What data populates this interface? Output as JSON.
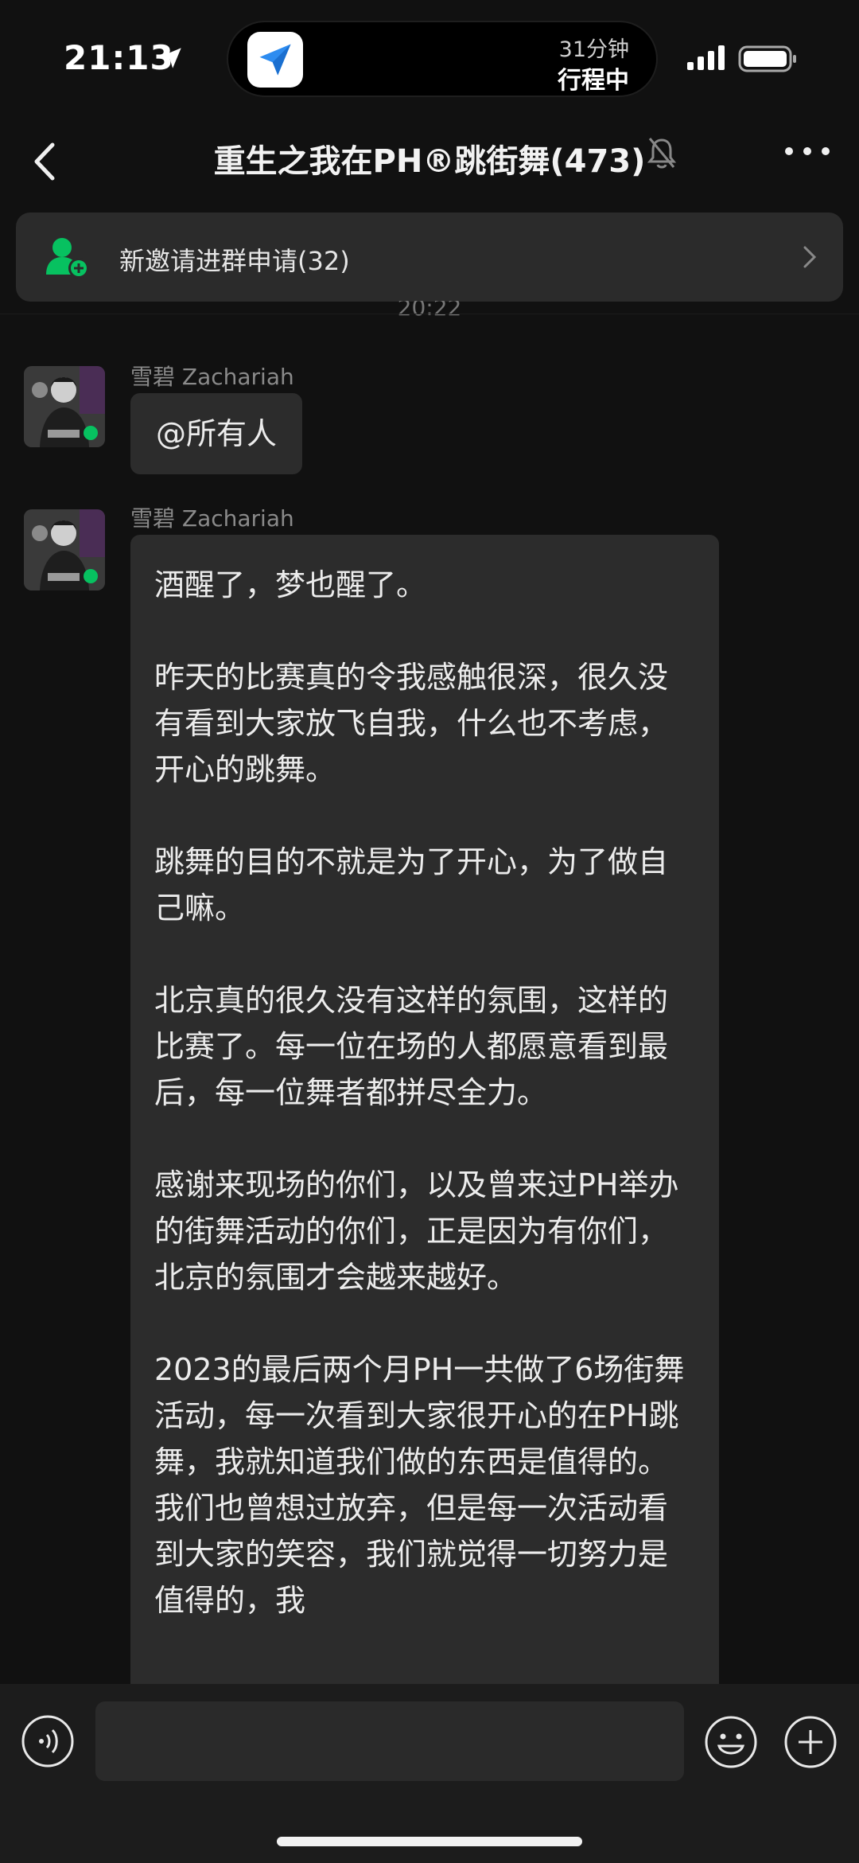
{
  "status_bar": {
    "time": "21:13",
    "trip_duration": "31分钟",
    "trip_status": "行程中"
  },
  "nav": {
    "title": "重生之我在PH®跳街舞(473)"
  },
  "banner": {
    "text": "新邀请进群申请(32)"
  },
  "timestamp": "20:22",
  "messages": [
    {
      "sender": "雪碧 Zachariah",
      "text": "@所有人"
    },
    {
      "sender": "雪碧 Zachariah",
      "paragraphs": [
        "酒醒了，梦也醒了。",
        "昨天的比赛真的令我感触很深，很久没有看到大家放飞自我，什么也不考虑，开心的跳舞。",
        "跳舞的目的不就是为了开心，为了做自己嘛。",
        "北京真的很久没有这样的氛围，这样的比赛了。每一位在场的人都愿意看到最后，每一位舞者都拼尽全力。",
        "感谢来现场的你们，以及曾来过PH举办的街舞活动的你们，正是因为有你们，北京的氛围才会越来越好。",
        "2023的最后两个月PH一共做了6场街舞活动，每一次看到大家很开心的在PH跳舞，我就知道我们做的东西是值得的。我们也曾想过放弃，但是每一次活动看到大家的笑容，我们就觉得一切努力是值得的，我"
      ]
    }
  ],
  "input": {
    "placeholder": ""
  },
  "colors": {
    "background": "#111111",
    "bubble": "#2c2c2c",
    "accent_green": "#07c160"
  }
}
